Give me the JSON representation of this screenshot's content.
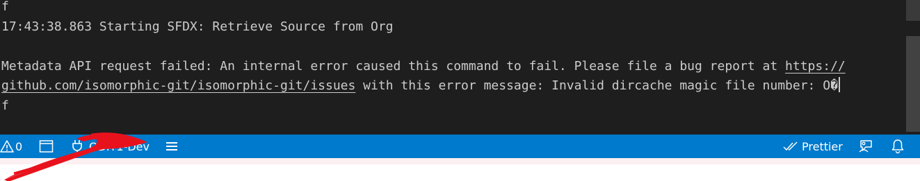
{
  "terminal": {
    "lines": [
      "f",
      "17:43:38.863 Starting SFDX: Retrieve Source from Org",
      "",
      "Metadata API request failed: An internal error caused this command to fail. Please file a bug report at ",
      "f"
    ],
    "link_part1": "https://",
    "link_part2": "github.com/isomorphic-git/isomorphic-git/issues",
    "line5_rest": " with this error message: Invalid dircache magic file number: O�"
  },
  "statusbar": {
    "warnings_count": "0",
    "org_name": "ODIT1-Dev",
    "prettier_label": "Prettier"
  },
  "colors": {
    "statusbar_bg": "#007acc",
    "terminal_bg": "#1e1e1e",
    "annotation_arrow": "#e8121d"
  },
  "icons": [
    "warning-icon",
    "panel-layout-icon",
    "plug-icon",
    "list-icon",
    "check-double-icon",
    "feedback-icon",
    "bell-icon"
  ]
}
